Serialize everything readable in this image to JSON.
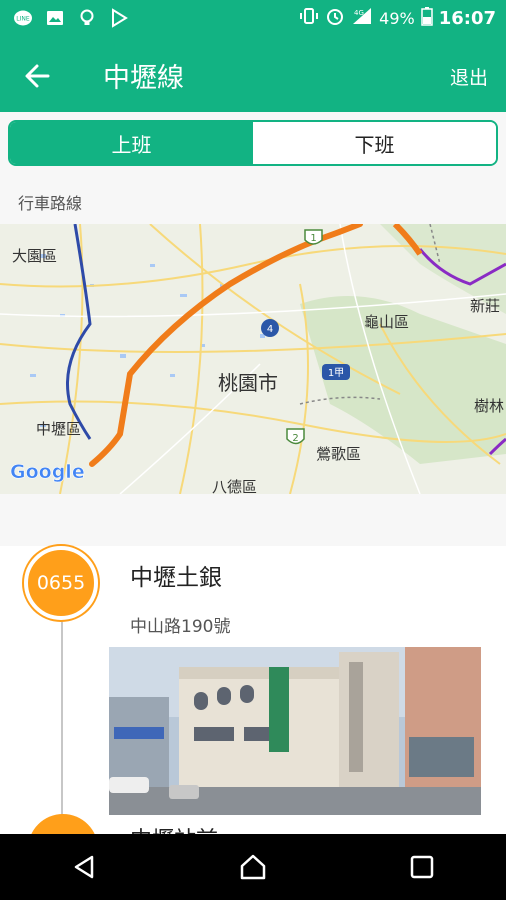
{
  "status_bar": {
    "battery": "49%",
    "time": "16:07",
    "signal_label": "4G"
  },
  "app_bar": {
    "title": "中壢線",
    "logout_label": "退出"
  },
  "tabs": [
    {
      "label": "上班",
      "active": true
    },
    {
      "label": "下班",
      "active": false
    }
  ],
  "section": {
    "label": "行車路線"
  },
  "map": {
    "labels": {
      "dayuan": "大園區",
      "taoyuan_city": "桃園市",
      "guishan": "龜山區",
      "zhongli": "中壢區",
      "bade": "八德區",
      "yingge": "鶯歌區",
      "xinzhuang": "新莊",
      "shulin": "樹林",
      "route_1": "1",
      "route_4": "4",
      "route_1a": "1甲",
      "route_2": "2",
      "google": "Google"
    },
    "route_color": "#f07c1a"
  },
  "stop": {
    "time": "0655",
    "name": "中壢土銀",
    "address": "中山路190號"
  },
  "next_stop": {
    "name": "中壢站前"
  },
  "colors": {
    "accent": "#12b383",
    "badge": "#ff9f1a"
  }
}
